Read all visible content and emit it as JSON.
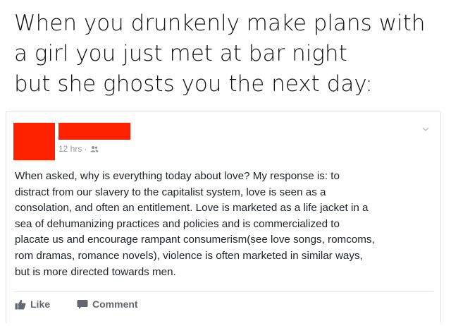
{
  "caption": {
    "lines": [
      "When you drunkenly make plans with",
      "a girl you just met at bar night",
      "but she ghosts you the next day:"
    ]
  },
  "post": {
    "timestamp": "12 hrs",
    "separator": "·",
    "audience_icon": "friends-icon",
    "redaction_color": "#ff2200",
    "body_lines": [
      "When asked, why is everything today about love? My response is: to",
      "distract from our slavery to the capitalist system, love is seen as a",
      "consolation, and often an entitlement. Love is marketed as a life jacket in a",
      "sea of dehumanizing practices and policies and is commercialized to",
      "placate us and encourage rampant consumerism(see love songs, romcoms,",
      "rom dramas, romance novels), violence is often marketed in similar ways,",
      "but is more directed towards men."
    ],
    "actions": {
      "like_label": "Like",
      "comment_label": "Comment"
    }
  }
}
